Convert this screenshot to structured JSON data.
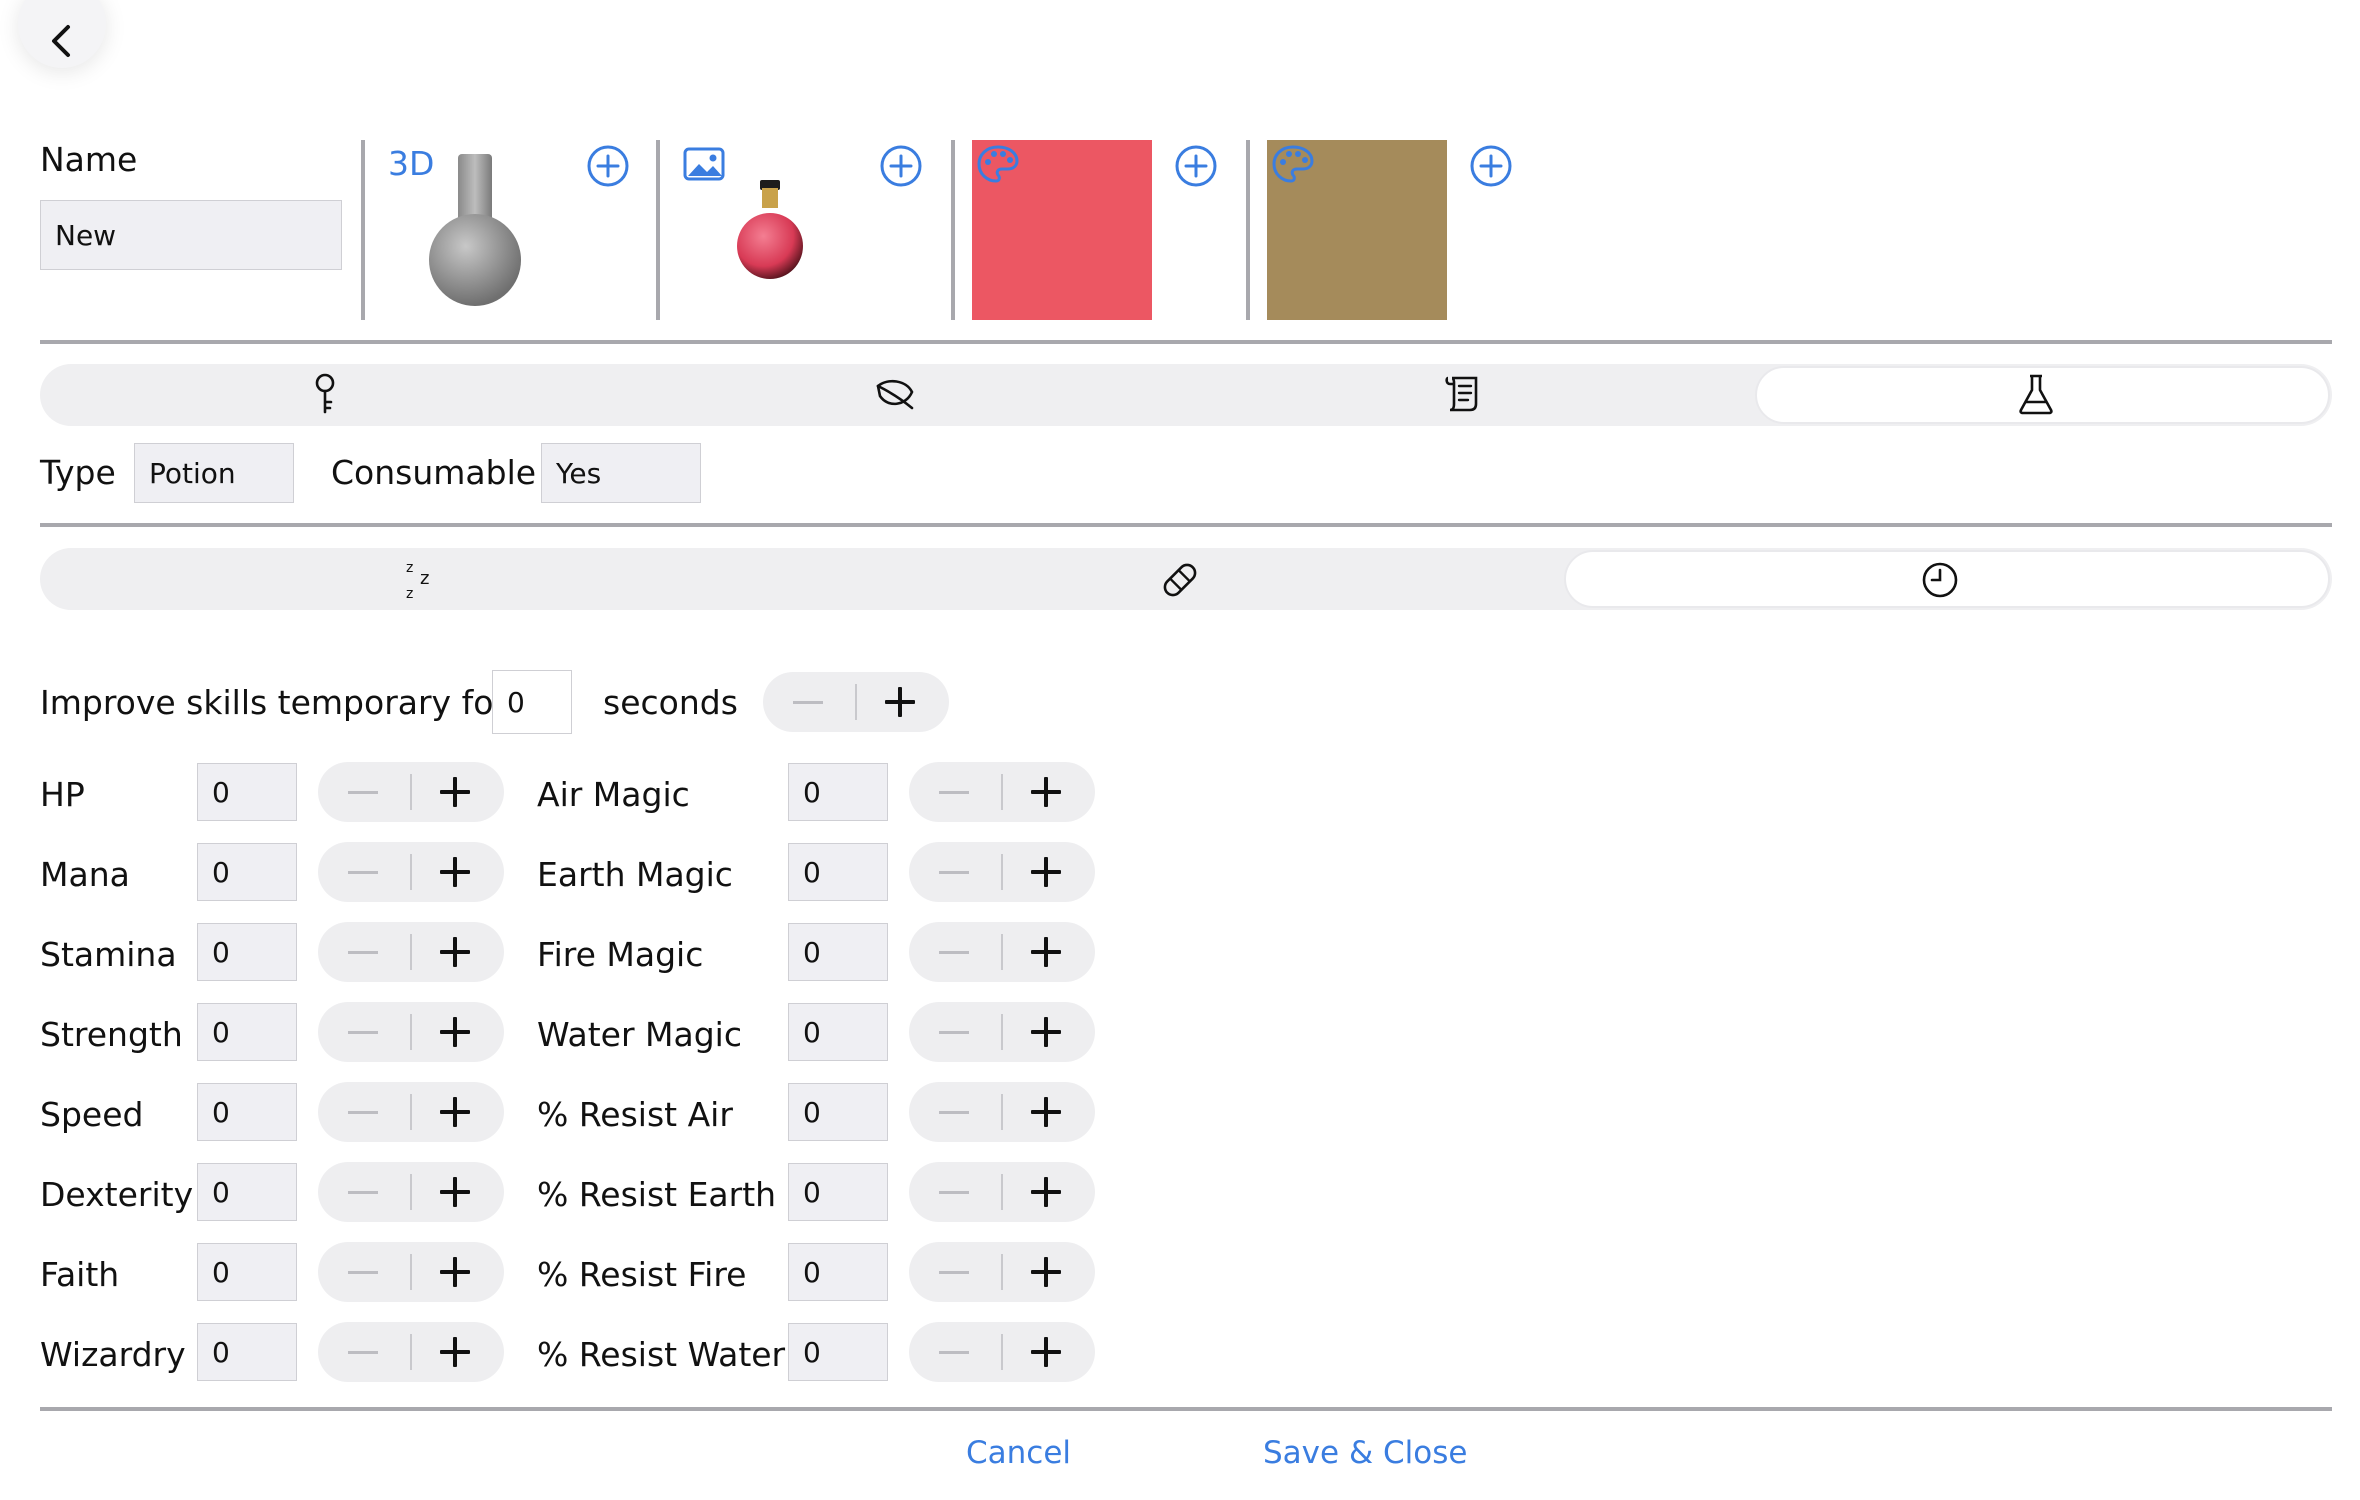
{
  "header": {
    "back_icon": "chevron-left-icon"
  },
  "name": {
    "label": "Name",
    "value": "New"
  },
  "assets": [
    {
      "kind_label": "3D",
      "icon": "cube-3d-icon",
      "preview": "gray-flask-model"
    },
    {
      "icon": "image-icon",
      "preview": "red-potion-image"
    },
    {
      "icon": "palette-icon",
      "color": "#ec5763"
    },
    {
      "icon": "palette-icon",
      "color": "#a58b5b"
    }
  ],
  "tabs": {
    "icons": [
      "key-icon",
      "leaf-icon",
      "scroll-icon",
      "flask-icon"
    ],
    "selected_index": 3
  },
  "properties": {
    "type_label": "Type",
    "type_value": "Potion",
    "consumable_label": "Consumable",
    "consumable_value": "Yes"
  },
  "subtabs": {
    "icons": [
      "sleep-icon",
      "bandage-icon",
      "clock-icon"
    ],
    "selected_index": 2
  },
  "timer": {
    "prefix": "Improve skills temporary for",
    "value": "0",
    "suffix": "seconds"
  },
  "left_stats": [
    {
      "label": "HP",
      "value": "0"
    },
    {
      "label": "Mana",
      "value": "0"
    },
    {
      "label": "Stamina",
      "value": "0"
    },
    {
      "label": "Strength",
      "value": "0"
    },
    {
      "label": "Speed",
      "value": "0"
    },
    {
      "label": "Dexterity",
      "value": "0"
    },
    {
      "label": "Faith",
      "value": "0"
    },
    {
      "label": "Wizardry",
      "value": "0"
    }
  ],
  "right_stats": [
    {
      "label": "Air Magic",
      "value": "0"
    },
    {
      "label": "Earth Magic",
      "value": "0"
    },
    {
      "label": "Fire Magic",
      "value": "0"
    },
    {
      "label": "Water Magic",
      "value": "0"
    },
    {
      "label": "% Resist Air",
      "value": "0"
    },
    {
      "label": "% Resist Earth",
      "value": "0"
    },
    {
      "label": "% Resist Fire",
      "value": "0"
    },
    {
      "label": "% Resist Water",
      "value": "0"
    }
  ],
  "footer": {
    "cancel": "Cancel",
    "save": "Save & Close"
  },
  "colors": {
    "accent": "#3a7de0",
    "separator": "#a8a8ad",
    "field_bg": "#efeff3"
  }
}
